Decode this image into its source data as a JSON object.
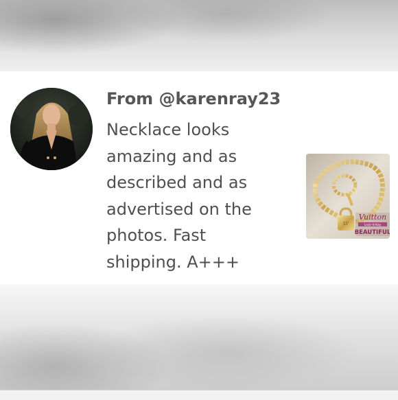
{
  "review": {
    "from_label": "From @karenray23",
    "text": "Necklace looks amazing and as described and as advertised on the photos. Fast shipping. A+++"
  },
  "product_image": {
    "brand_text": "Vuitton",
    "tag_text": "Lock-it-Key",
    "caption_text": "BEAUTIFUL"
  },
  "colors": {
    "text_primary": "#565656",
    "card_background": "#ffffff",
    "backdrop": "#d8d8d8"
  },
  "icons": {
    "avatar": "user-avatar-photo",
    "thumbnail": "product-photo"
  }
}
